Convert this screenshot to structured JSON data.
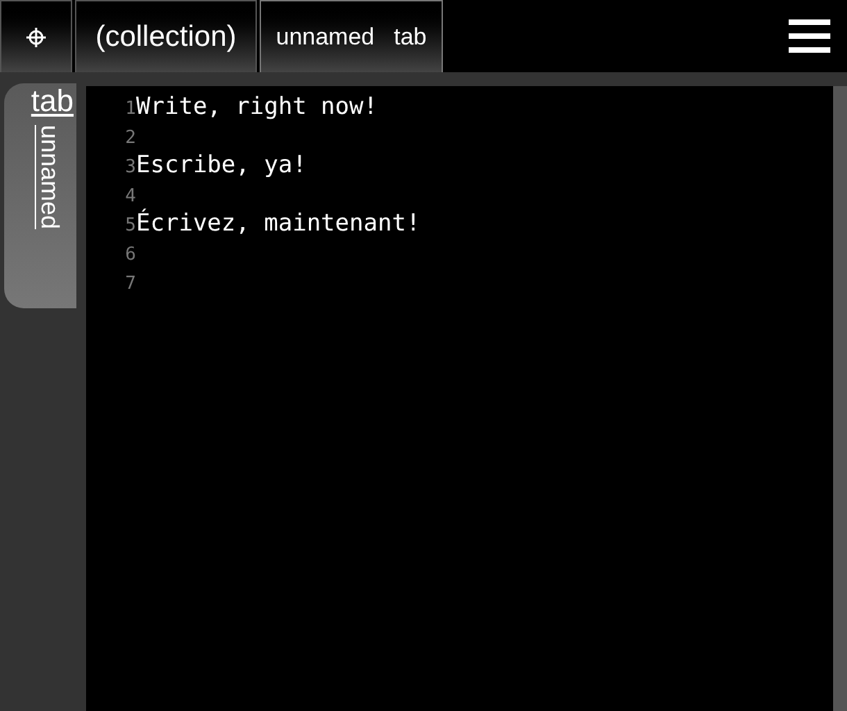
{
  "tabs": [
    {
      "kind": "icon",
      "selected": false
    },
    {
      "kind": "text",
      "label": "(collection)",
      "selected": false
    },
    {
      "kind": "split",
      "label": [
        "unnamed",
        "tab"
      ],
      "selected": true
    }
  ],
  "side_tab": {
    "title": "tab",
    "subtitle": "unnamed",
    "selected": true
  },
  "editor": {
    "lines": [
      {
        "number": "1",
        "text": "Write, right now!"
      },
      {
        "number": "2"
      },
      {
        "number": "3",
        "text": "Escribe, ya!"
      },
      {
        "number": "4"
      },
      {
        "number": "5",
        "text": "Écrivez, maintenant!"
      },
      {
        "number": "6"
      },
      {
        "number": "7"
      }
    ]
  }
}
